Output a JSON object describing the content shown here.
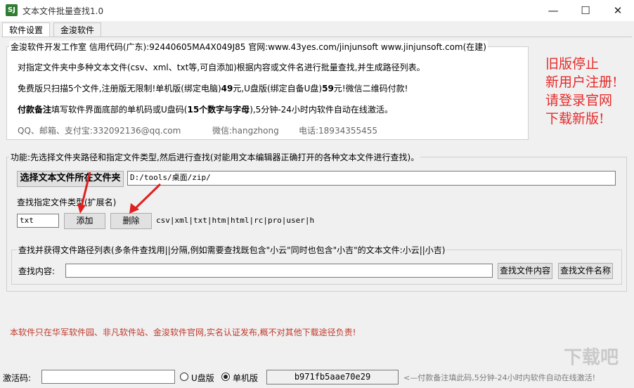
{
  "window": {
    "title": "文本文件批量查找1.0",
    "icon_text": "SJ",
    "minimize": "—",
    "maximize": "☐",
    "close": "✕"
  },
  "tabs": [
    {
      "label": "软件设置",
      "active": true
    },
    {
      "label": "金浚软件",
      "active": false
    }
  ],
  "info_box": {
    "legend": "金浚软件开发工作室 信用代码(广东):92440605MA4X049J85 官网:www.43yes.com/jinjunsoft  www.jinjunsoft.com(在建)",
    "line1": "对指定文件夹中多种文本文件(csv、xml、txt等,可自添加)根据内容或文件名进行批量查找,并生成路径列表。",
    "line2_pre": "免费版只扫描5个文件,注册版无限制!单机版(绑定电脑)",
    "line2_price1": "49",
    "line2_mid": "元,U盘版(绑定自备U盘)",
    "line2_price2": "59",
    "line2_post": "元!微信二维码付款!",
    "line3_bold": "付款备注",
    "line3_mid": "填写软件界面底部的单机码或U盘码(",
    "line3_bold2": "15个数字与字母",
    "line3_post": "),5分钟-24小时内软件自动在线激活。",
    "contact_qq": "QQ、邮箱、支付宝:332092136@qq.com",
    "contact_wechat": "微信:hangzhong",
    "contact_phone": "电话:18934355455"
  },
  "notice": {
    "line1": "旧版停止",
    "line2": "新用户注册!",
    "line3": "请登录官网",
    "line4": "下载新版!"
  },
  "function_box": {
    "legend": "功能:先选择文件夹路径和指定文件类型,然后进行查找(对能用文本编辑器正确打开的各种文本文件进行查找)。",
    "select_folder_button": "选择文本文件所在文件夹",
    "folder_path": "D:/tools/桌面/zip/",
    "ext_label": "查找指定文件类型(扩展名)",
    "ext_value": "txt",
    "add_button": "添加",
    "delete_button": "删除",
    "ext_list": "csv|xml|txt|htm|html|rc|pro|user|h"
  },
  "search_box": {
    "legend": "查找并获得文件路径列表(多条件查找用||分隔,例如需要查找既包含\"小云\"同时也包含\"小吉\"的文本文件:小云||小吉)",
    "content_label": "查找内容:",
    "content_value": "",
    "find_content_button": "查找文件内容",
    "find_name_button": "查找文件名称"
  },
  "footer_notice": "本软件只在华军软件园、非凡软件站、金浚软件官网,实名认证发布,概不对其他下载途径负责!",
  "bottom": {
    "activation_label": "激活码:",
    "activation_value": "",
    "radio_usb": "U盘版",
    "radio_single": "单机版",
    "machine_code": "b971fb5aae70e29",
    "hint": "<—付款备注填此码,5分钟-24小时内软件自动在线激活!"
  },
  "watermark": "下载吧",
  "colors": {
    "notice_red": "#e52a2a",
    "footer_red": "#c0392b",
    "hint_gray": "#7b7b7b",
    "arrow_red": "#e02020"
  }
}
